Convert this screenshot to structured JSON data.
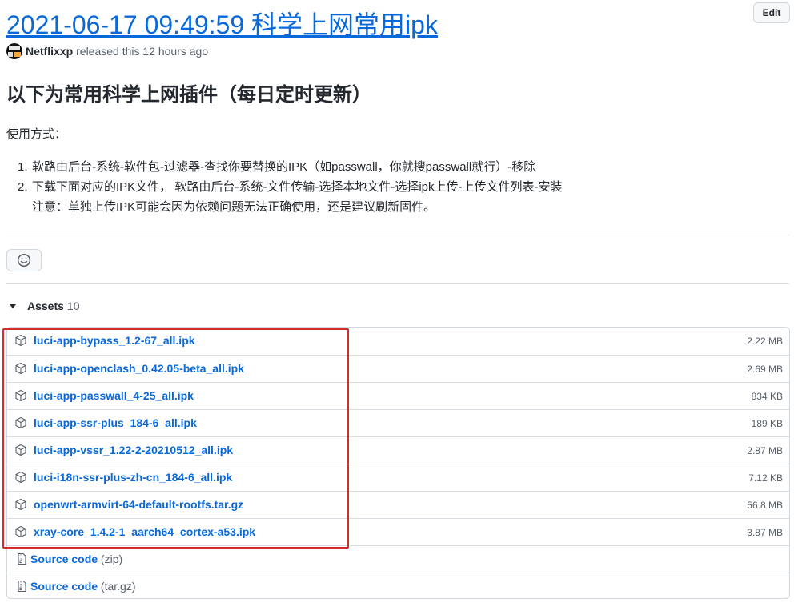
{
  "release": {
    "title": "2021-06-17 09:49:59 科学上网常用ipk",
    "edit_label": "Edit",
    "author": "Netflixxp",
    "released_text": "released this 12 hours ago"
  },
  "body": {
    "heading": "以下为常用科学上网插件（每日定时更新）",
    "usage_label": "使用方式：",
    "steps": [
      {
        "num": "1.",
        "text": "软路由后台-系统-软件包-过滤器-查找你要替换的IPK（如passwall，你就搜passwall就行）-移除"
      },
      {
        "num": "2.",
        "text": "下载下面对应的IPK文件， 软路由后台-系统-文件传输-选择本地文件-选择ipk上传-上传文件列表-安装"
      }
    ],
    "note": "注意：单独上传IPK可能会因为依赖问题无法正确使用，还是建议刷新固件。"
  },
  "reactions": {
    "icon": "smiley-icon"
  },
  "assets": {
    "label": "Assets",
    "count": "10",
    "files": [
      {
        "name": "luci-app-bypass_1.2-67_all.ipk",
        "size": "2.22 MB"
      },
      {
        "name": "luci-app-openclash_0.42.05-beta_all.ipk",
        "size": "2.69 MB"
      },
      {
        "name": "luci-app-passwall_4-25_all.ipk",
        "size": "834 KB"
      },
      {
        "name": "luci-app-ssr-plus_184-6_all.ipk",
        "size": "189 KB"
      },
      {
        "name": "luci-app-vssr_1.22-2-20210512_all.ipk",
        "size": "2.87 MB"
      },
      {
        "name": "luci-i18n-ssr-plus-zh-cn_184-6_all.ipk",
        "size": "7.12 KB"
      },
      {
        "name": "openwrt-armvirt-64-default-rootfs.tar.gz",
        "size": "56.8 MB"
      },
      {
        "name": "xray-core_1.4.2-1_aarch64_cortex-a53.ipk",
        "size": "3.87 MB"
      }
    ],
    "source": [
      {
        "label": "Source code",
        "format": "(zip)"
      },
      {
        "label": "Source code",
        "format": "(tar.gz)"
      }
    ]
  },
  "colors": {
    "link": "#0969da",
    "highlight_border": "#d42b2b",
    "muted": "#57606a"
  }
}
